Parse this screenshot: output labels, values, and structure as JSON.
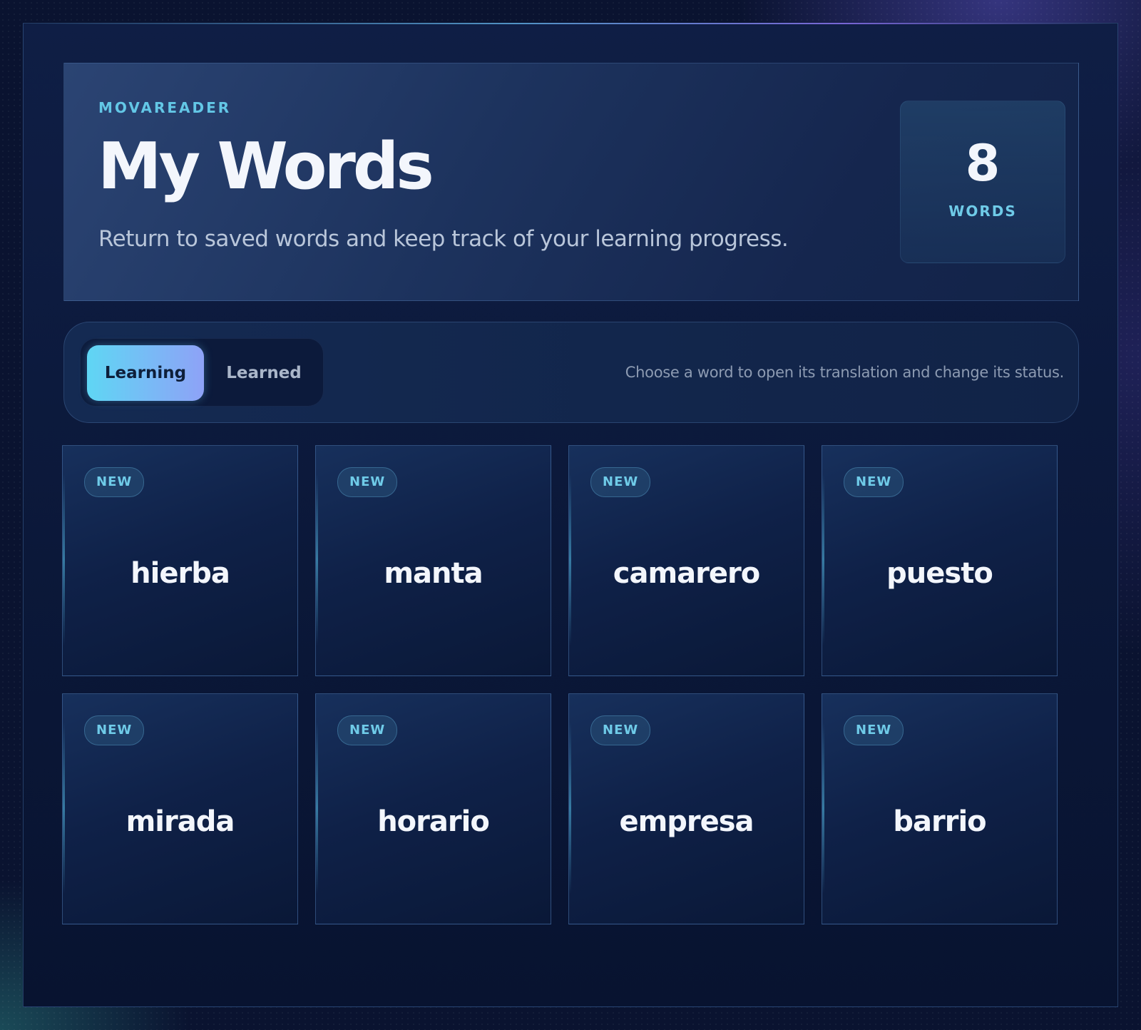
{
  "header": {
    "brand": "MOVAREADER",
    "title": "My Words",
    "subtitle": "Return to saved words and keep track of your learning progress.",
    "word_count": {
      "value": "8",
      "label": "WORDS"
    }
  },
  "toolbar": {
    "tabs": [
      {
        "label": "Learning",
        "active": true
      },
      {
        "label": "Learned",
        "active": false
      }
    ],
    "hint": "Choose a word to open its translation and change its status."
  },
  "words": [
    {
      "badge": "NEW",
      "word": "hierba"
    },
    {
      "badge": "NEW",
      "word": "manta"
    },
    {
      "badge": "NEW",
      "word": "camarero"
    },
    {
      "badge": "NEW",
      "word": "puesto"
    },
    {
      "badge": "NEW",
      "word": "mirada"
    },
    {
      "badge": "NEW",
      "word": "horario"
    },
    {
      "badge": "NEW",
      "word": "empresa"
    },
    {
      "badge": "NEW",
      "word": "barrio"
    }
  ],
  "colors": {
    "accent": "#63c7e6",
    "tab_active_start": "#5fd6f4",
    "tab_active_end": "#8ea2f7",
    "background": "#0a1330"
  }
}
